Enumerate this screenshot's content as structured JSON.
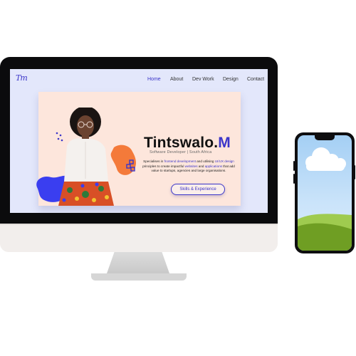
{
  "site": {
    "logo": "Tm",
    "nav": [
      {
        "label": "Home",
        "active": true
      },
      {
        "label": "About",
        "active": false
      },
      {
        "label": "Dev Work",
        "active": false
      },
      {
        "label": "Design",
        "active": false
      },
      {
        "label": "Contact",
        "active": false
      }
    ],
    "hero": {
      "name_main": "Tintswalo.",
      "name_accent": "M",
      "subtitle": "Software Developer  |  South Africa",
      "desc_1": "Specialises in ",
      "desc_hl_1": "frontend development",
      "desc_2": " and utilising ",
      "desc_hl_2": "UI/UX design",
      "desc_3": " principles to create impactful ",
      "desc_hl_3": "websites",
      "desc_4": " and ",
      "desc_hl_4": "applications",
      "desc_5": " that add value to startups, agencies and large organisations.",
      "cta_label": "Skills & Experience"
    }
  },
  "colors": {
    "accent": "#3b35c9",
    "card_bg": "#fde6dc",
    "screen_bg": "#e3e7fb",
    "blob_orange": "#f47a3a",
    "blob_blue": "#3a3ef0"
  },
  "icons": [
    "woman-portrait-photo",
    "cloud-icon",
    "hills-icon"
  ]
}
